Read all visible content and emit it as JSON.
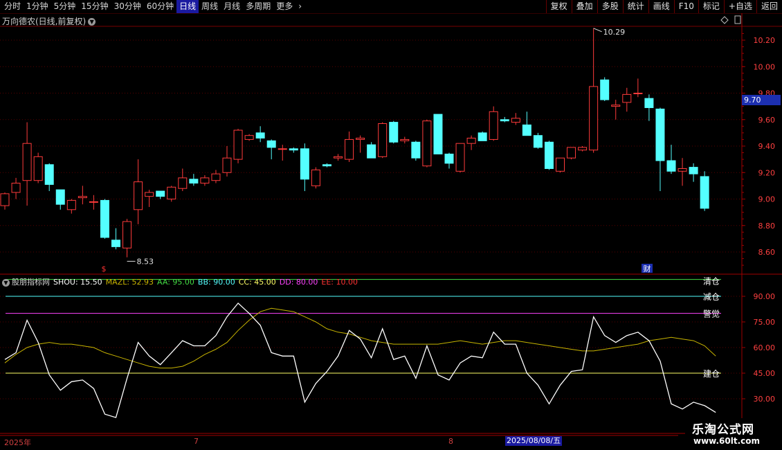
{
  "toolbar": {
    "periods": [
      "分时",
      "1分钟",
      "5分钟",
      "15分钟",
      "30分钟",
      "60分钟",
      "日线",
      "周线",
      "月线",
      "多周期",
      "更多"
    ],
    "active_period": "日线",
    "right_buttons": [
      "复权",
      "叠加",
      "多股",
      "统计",
      "画线",
      "F10",
      "标记",
      "+自选",
      "返回"
    ]
  },
  "stock_title": "万向德农(日线,前复权)",
  "current_price_tag": "9.70",
  "price_axis_labels": [
    "10.20",
    "10.00",
    "9.80",
    "9.60",
    "9.40",
    "9.20",
    "9.00",
    "8.80",
    "8.60"
  ],
  "high_marker": "10.29",
  "low_marker": "8.53",
  "event_markers": {
    "left": "$",
    "right": "财"
  },
  "indicator": {
    "name": "股朋指标网",
    "shou": "SHOU: 15.50",
    "mazl": "MAZL: 52.93",
    "aa": "AA: 95.00",
    "bb": "BB: 90.00",
    "cc": "CC: 45.00",
    "dd": "DD: 80.00",
    "ee": "EE: 10.00",
    "axis_labels": [
      "90.00",
      "75.00",
      "60.00",
      "45.00",
      "30.00"
    ],
    "line_labels": {
      "aa": "清仓",
      "bb": "减仓",
      "dd": "警觉",
      "cc": "建仓"
    }
  },
  "time_axis": {
    "year": "2025年",
    "m7": "7",
    "m8": "8",
    "selected_date": "2025/08/08/五"
  },
  "watermark": {
    "line1": "乐淘公式网",
    "line2": "www.60lt.com"
  },
  "colors": {
    "up": "#ff3b3b",
    "down": "#54ffff",
    "shou": "#ffffff",
    "mazl": "#c8b400",
    "aa": "#44dd44",
    "bb": "#54ffff",
    "cc": "#ffff66",
    "dd": "#ff44ff",
    "ee": "#ff3333"
  },
  "chart_data": {
    "type": "candlestick",
    "ylim": [
      8.5,
      10.35
    ],
    "candles": [
      {
        "o": 8.95,
        "h": 9.05,
        "l": 8.92,
        "c": 9.04
      },
      {
        "o": 9.05,
        "h": 9.16,
        "l": 9.0,
        "c": 9.12
      },
      {
        "o": 9.14,
        "h": 9.58,
        "l": 8.95,
        "c": 9.42
      },
      {
        "o": 9.14,
        "h": 9.35,
        "l": 9.12,
        "c": 9.32
      },
      {
        "o": 9.26,
        "h": 9.27,
        "l": 9.06,
        "c": 9.11
      },
      {
        "o": 9.07,
        "h": 9.07,
        "l": 8.92,
        "c": 8.96
      },
      {
        "o": 8.92,
        "h": 9.0,
        "l": 8.89,
        "c": 8.99
      },
      {
        "o": 9.01,
        "h": 9.1,
        "l": 8.96,
        "c": 9.02
      },
      {
        "o": 8.98,
        "h": 9.03,
        "l": 8.92,
        "c": 8.98
      },
      {
        "o": 8.99,
        "h": 9.0,
        "l": 8.7,
        "c": 8.71
      },
      {
        "o": 8.69,
        "h": 8.78,
        "l": 8.62,
        "c": 8.64
      },
      {
        "o": 8.63,
        "h": 8.85,
        "l": 8.56,
        "c": 8.83
      },
      {
        "o": 8.92,
        "h": 9.3,
        "l": 8.81,
        "c": 9.13
      },
      {
        "o": 9.02,
        "h": 9.07,
        "l": 8.94,
        "c": 9.05
      },
      {
        "o": 9.06,
        "h": 9.06,
        "l": 9.0,
        "c": 9.02
      },
      {
        "o": 9.0,
        "h": 9.1,
        "l": 8.98,
        "c": 9.09
      },
      {
        "o": 9.08,
        "h": 9.23,
        "l": 9.06,
        "c": 9.16
      },
      {
        "o": 9.15,
        "h": 9.19,
        "l": 9.1,
        "c": 9.12
      },
      {
        "o": 9.12,
        "h": 9.18,
        "l": 9.1,
        "c": 9.16
      },
      {
        "o": 9.14,
        "h": 9.22,
        "l": 9.12,
        "c": 9.19
      },
      {
        "o": 9.2,
        "h": 9.4,
        "l": 9.17,
        "c": 9.31
      },
      {
        "o": 9.3,
        "h": 9.53,
        "l": 9.27,
        "c": 9.52
      },
      {
        "o": 9.45,
        "h": 9.49,
        "l": 9.44,
        "c": 9.48
      },
      {
        "o": 9.5,
        "h": 9.55,
        "l": 9.43,
        "c": 9.46
      },
      {
        "o": 9.44,
        "h": 9.45,
        "l": 9.3,
        "c": 9.39
      },
      {
        "o": 9.38,
        "h": 9.41,
        "l": 9.29,
        "c": 9.38
      },
      {
        "o": 9.38,
        "h": 9.39,
        "l": 9.35,
        "c": 9.37
      },
      {
        "o": 9.38,
        "h": 9.42,
        "l": 9.06,
        "c": 9.15
      },
      {
        "o": 9.1,
        "h": 9.24,
        "l": 9.08,
        "c": 9.22
      },
      {
        "o": 9.26,
        "h": 9.27,
        "l": 9.24,
        "c": 9.25
      },
      {
        "o": 9.31,
        "h": 9.34,
        "l": 9.29,
        "c": 9.32
      },
      {
        "o": 9.3,
        "h": 9.51,
        "l": 9.28,
        "c": 9.45
      },
      {
        "o": 9.45,
        "h": 9.48,
        "l": 9.35,
        "c": 9.46
      },
      {
        "o": 9.41,
        "h": 9.43,
        "l": 9.32,
        "c": 9.31
      },
      {
        "o": 9.32,
        "h": 9.58,
        "l": 9.31,
        "c": 9.57
      },
      {
        "o": 9.58,
        "h": 9.59,
        "l": 9.42,
        "c": 9.43
      },
      {
        "o": 9.44,
        "h": 9.47,
        "l": 9.42,
        "c": 9.45
      },
      {
        "o": 9.43,
        "h": 9.44,
        "l": 9.29,
        "c": 9.31
      },
      {
        "o": 9.25,
        "h": 9.6,
        "l": 9.24,
        "c": 9.59
      },
      {
        "o": 9.64,
        "h": 9.64,
        "l": 9.35,
        "c": 9.34
      },
      {
        "o": 9.34,
        "h": 9.35,
        "l": 9.23,
        "c": 9.27
      },
      {
        "o": 9.21,
        "h": 9.42,
        "l": 9.2,
        "c": 9.42
      },
      {
        "o": 9.42,
        "h": 9.48,
        "l": 9.37,
        "c": 9.46
      },
      {
        "o": 9.5,
        "h": 9.51,
        "l": 9.44,
        "c": 9.44
      },
      {
        "o": 9.45,
        "h": 9.7,
        "l": 9.44,
        "c": 9.66
      },
      {
        "o": 9.6,
        "h": 9.62,
        "l": 9.58,
        "c": 9.59
      },
      {
        "o": 9.58,
        "h": 9.65,
        "l": 9.56,
        "c": 9.61
      },
      {
        "o": 9.56,
        "h": 9.66,
        "l": 9.49,
        "c": 9.48
      },
      {
        "o": 9.48,
        "h": 9.5,
        "l": 9.38,
        "c": 9.39
      },
      {
        "o": 9.43,
        "h": 9.44,
        "l": 9.22,
        "c": 9.23
      },
      {
        "o": 9.21,
        "h": 9.31,
        "l": 9.2,
        "c": 9.31
      },
      {
        "o": 9.31,
        "h": 9.37,
        "l": 9.3,
        "c": 9.39
      },
      {
        "o": 9.37,
        "h": 9.4,
        "l": 9.36,
        "c": 9.39
      },
      {
        "o": 9.37,
        "h": 10.29,
        "l": 9.35,
        "c": 9.85
      },
      {
        "o": 9.9,
        "h": 9.92,
        "l": 9.74,
        "c": 9.75
      },
      {
        "o": 9.7,
        "h": 9.75,
        "l": 9.6,
        "c": 9.71
      },
      {
        "o": 9.73,
        "h": 9.84,
        "l": 9.66,
        "c": 9.79
      },
      {
        "o": 9.8,
        "h": 9.91,
        "l": 9.77,
        "c": 9.8
      },
      {
        "o": 9.76,
        "h": 9.79,
        "l": 9.59,
        "c": 9.69
      },
      {
        "o": 9.68,
        "h": 9.69,
        "l": 9.06,
        "c": 9.29
      },
      {
        "o": 9.29,
        "h": 9.41,
        "l": 9.19,
        "c": 9.21
      },
      {
        "o": 9.21,
        "h": 9.31,
        "l": 9.1,
        "c": 9.23
      },
      {
        "o": 9.24,
        "h": 9.27,
        "l": 9.13,
        "c": 9.19
      },
      {
        "o": 9.17,
        "h": 9.21,
        "l": 8.91,
        "c": 8.93
      }
    ],
    "indicator_series": {
      "shou": [
        53,
        57,
        76,
        63,
        44,
        35,
        40,
        41,
        36,
        21,
        19,
        42,
        63,
        55,
        50,
        57,
        64,
        61,
        61,
        67,
        78,
        86,
        80,
        73,
        57,
        55,
        55,
        28,
        39,
        46,
        55,
        70,
        65,
        54,
        71,
        53,
        55,
        42,
        61,
        44,
        41,
        51,
        55,
        54,
        69,
        62,
        62,
        45,
        38,
        27,
        38,
        46,
        47,
        78,
        67,
        63,
        67,
        69,
        64,
        52,
        27,
        24,
        28,
        26,
        22
      ],
      "mazl": [
        51,
        56,
        60,
        62,
        63,
        62,
        62,
        61,
        60,
        57,
        55,
        53,
        51,
        49,
        48,
        48,
        49,
        52,
        56,
        59,
        63,
        70,
        76,
        81,
        83,
        82,
        81,
        78,
        75,
        71,
        69,
        68,
        66,
        64,
        63,
        62,
        62,
        62,
        62,
        62,
        63,
        64,
        63,
        62,
        63,
        64,
        64,
        63,
        62,
        61,
        60,
        59,
        58,
        58,
        59,
        60,
        61,
        62,
        64,
        65,
        66,
        65,
        64,
        61,
        55
      ]
    },
    "reference_lines": {
      "aa": 95,
      "bb": 90,
      "dd": 80,
      "cc": 45,
      "ee": 10
    },
    "ind_ylim": [
      20,
      100
    ]
  }
}
